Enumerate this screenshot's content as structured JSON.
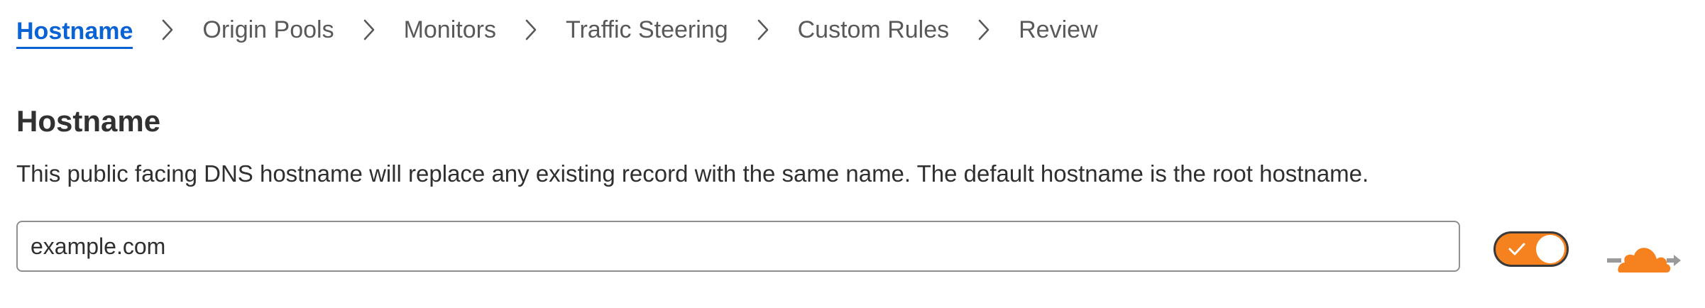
{
  "stepper": {
    "steps": [
      {
        "label": "Hostname",
        "active": true
      },
      {
        "label": "Origin Pools",
        "active": false
      },
      {
        "label": "Monitors",
        "active": false
      },
      {
        "label": "Traffic Steering",
        "active": false
      },
      {
        "label": "Custom Rules",
        "active": false
      },
      {
        "label": "Review",
        "active": false
      }
    ],
    "separator_icon": "chevron-right-icon"
  },
  "section": {
    "title": "Hostname",
    "description": "This public facing DNS hostname will replace any existing record with the same name. The default hostname is the root hostname."
  },
  "hostname_field": {
    "value": "example.com"
  },
  "proxy_toggle": {
    "on": true,
    "icon": "check-icon",
    "status_icon": "proxied-cloud-icon"
  },
  "colors": {
    "active_link": "#0a63d5",
    "brand_orange": "#f6821f",
    "text": "#313131",
    "muted_text": "#595959",
    "input_border": "#8f8f8f"
  }
}
